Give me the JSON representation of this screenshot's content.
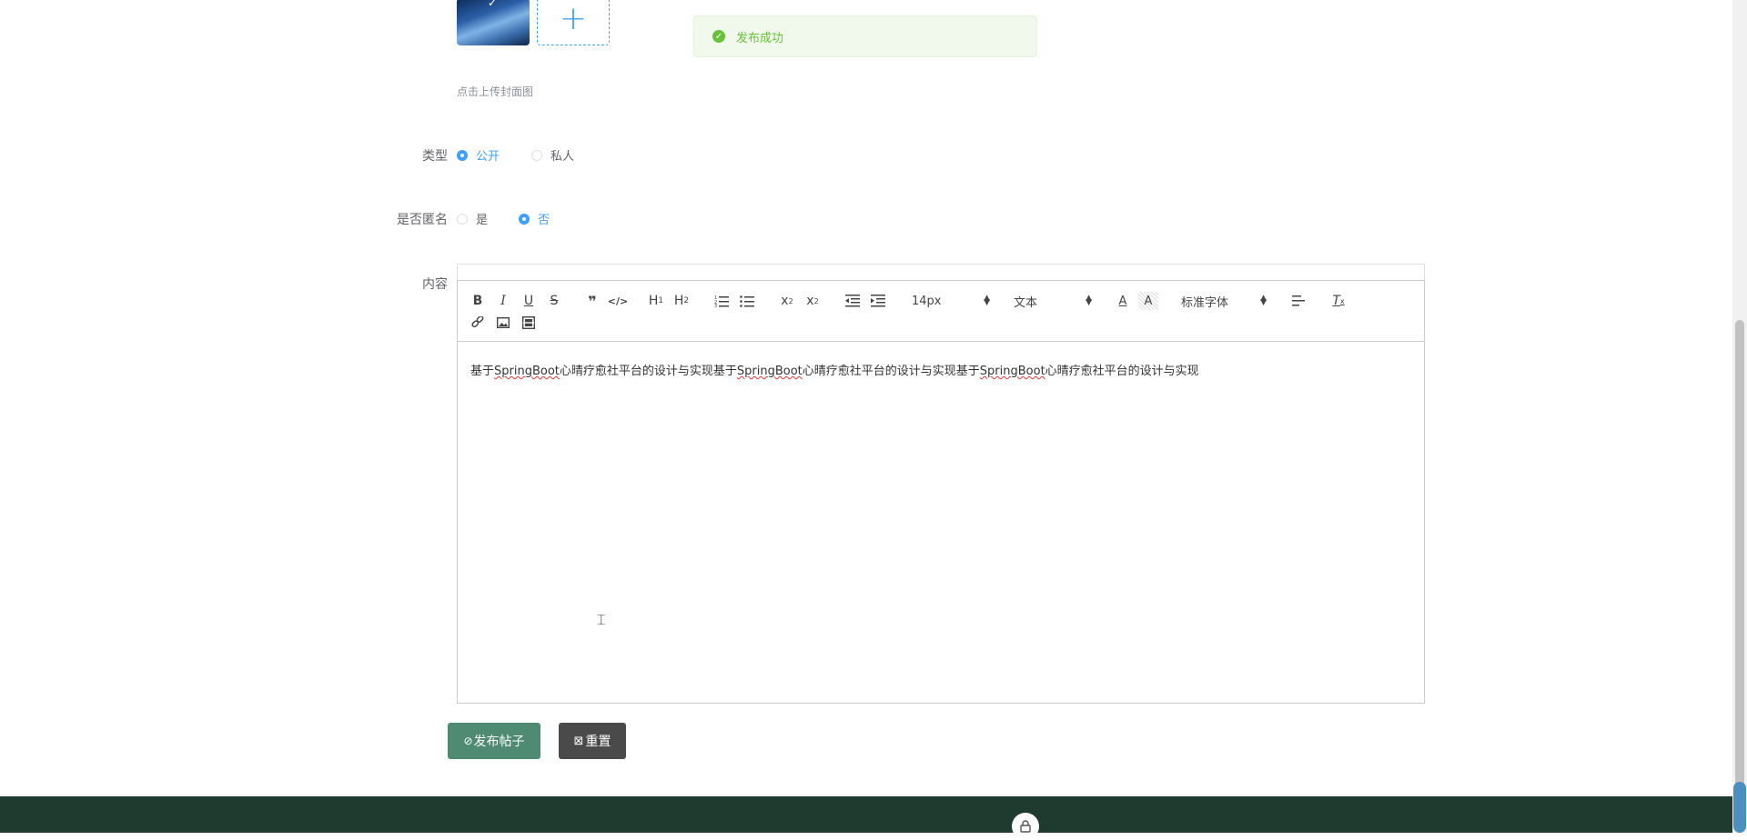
{
  "upload": {
    "hint": "点击上传封面图",
    "add_symbol": "+",
    "check_symbol": "✓"
  },
  "toast": {
    "message": "发布成功",
    "icon": "check-circle-icon",
    "color": "#67c23a"
  },
  "form": {
    "type": {
      "label": "类型",
      "options": [
        {
          "label": "公开",
          "checked": true
        },
        {
          "label": "私人",
          "checked": false
        }
      ]
    },
    "anonymous": {
      "label": "是否匿名",
      "options": [
        {
          "label": "是",
          "checked": false
        },
        {
          "label": "否",
          "checked": true
        }
      ]
    },
    "content": {
      "label": "内容",
      "toolbar": {
        "font_size": "14px",
        "header": "文本",
        "font_family": "标准字体",
        "icons": [
          "bold-icon",
          "italic-icon",
          "underline-icon",
          "strikethrough-icon",
          "blockquote-icon",
          "code-block-icon",
          "h1-icon",
          "h2-icon",
          "ordered-list-icon",
          "bullet-list-icon",
          "subscript-icon",
          "superscript-icon",
          "outdent-icon",
          "indent-icon",
          "font-color-icon",
          "background-color-icon",
          "align-icon",
          "clean-format-icon",
          "link-icon",
          "image-icon",
          "video-icon"
        ]
      },
      "text_parts": [
        "基于",
        "SpringBoot",
        "心晴疗愈社平台的设计与实现基于",
        "SpringBoot",
        "心晴疗愈社平台的设计与实现基于",
        "SpringBoot",
        "心晴疗愈社平台的设计与实现"
      ]
    }
  },
  "buttons": {
    "publish": "发布帖子",
    "reset": "重置",
    "publish_color": "#4f8a72",
    "reset_color": "#4a4a4a"
  },
  "footer": {
    "color": "#1f3b30",
    "icon": "lock-icon"
  }
}
